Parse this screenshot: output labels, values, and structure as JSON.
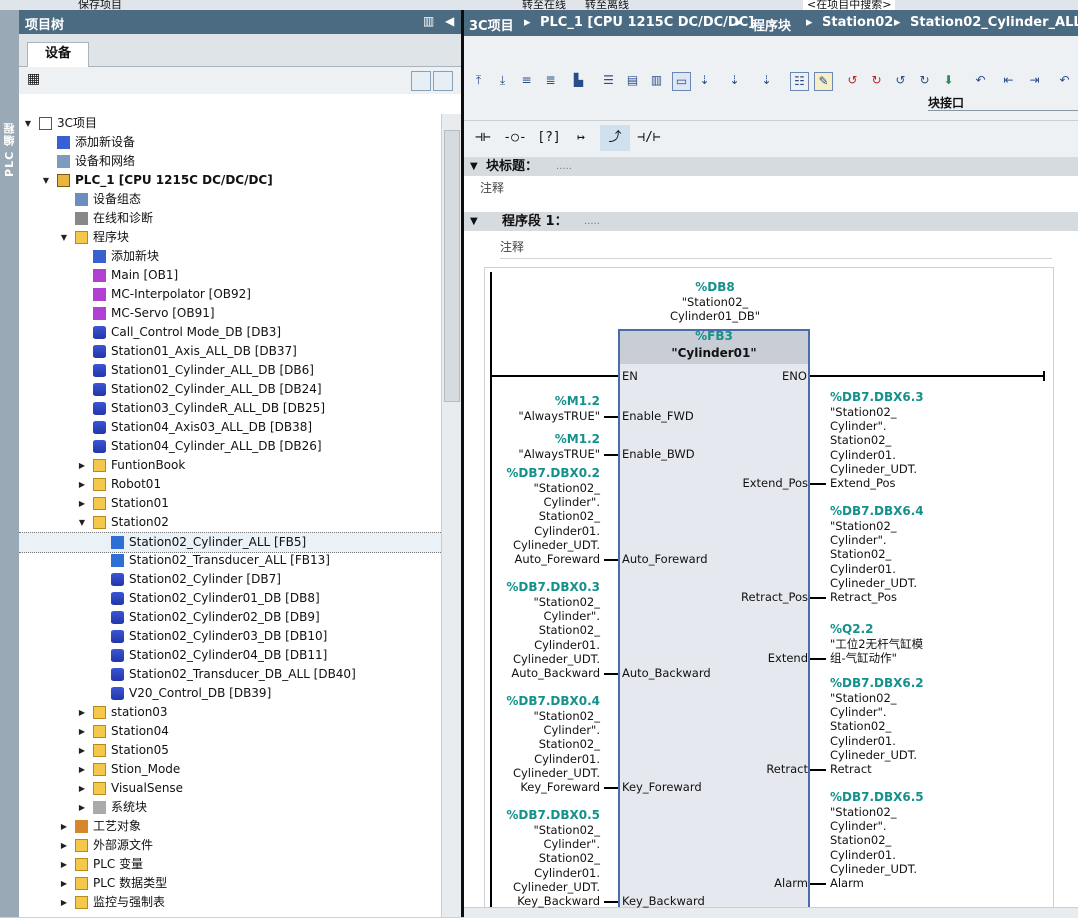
{
  "topbar": {
    "items": [
      "保存项目",
      "转至在线",
      "转至离线",
      "<在项目中搜索>"
    ]
  },
  "left_tab": {
    "label": "PLC 编程"
  },
  "tree_panel": {
    "title": "项目树",
    "tab": "设备",
    "rows": [
      {
        "arrow": "▼",
        "icon": "proj",
        "label": "3C项目"
      },
      {
        "arrow": "",
        "icon": "add",
        "label": "添加新设备"
      },
      {
        "arrow": "",
        "icon": "net",
        "label": "设备和网络"
      },
      {
        "arrow": "▼",
        "icon": "plc",
        "label": "PLC_1 [CPU 1215C DC/DC/DC]",
        "bold": true
      },
      {
        "arrow": "",
        "icon": "dev",
        "label": "设备组态"
      },
      {
        "arrow": "",
        "icon": "online",
        "label": "在线和诊断"
      },
      {
        "arrow": "▼",
        "icon": "folder",
        "label": "程序块"
      },
      {
        "arrow": "",
        "icon": "add",
        "label": "添加新块"
      },
      {
        "arrow": "",
        "icon": "ob",
        "label": "Main [OB1]"
      },
      {
        "arrow": "",
        "icon": "ob",
        "label": "MC-Interpolator [OB92]"
      },
      {
        "arrow": "",
        "icon": "ob",
        "label": "MC-Servo [OB91]"
      },
      {
        "arrow": "",
        "icon": "db",
        "label": "Call_Control Mode_DB [DB3]"
      },
      {
        "arrow": "",
        "icon": "db",
        "label": "Station01_Axis_ALL_DB [DB37]"
      },
      {
        "arrow": "",
        "icon": "db",
        "label": "Station01_Cylinder_ALL_DB [DB6]"
      },
      {
        "arrow": "",
        "icon": "db",
        "label": "Station02_Cylinder_ALL_DB [DB24]"
      },
      {
        "arrow": "",
        "icon": "db",
        "label": "Station03_CylindeR_ALL_DB [DB25]"
      },
      {
        "arrow": "",
        "icon": "db",
        "label": "Station04_Axis03_ALL_DB [DB38]"
      },
      {
        "arrow": "",
        "icon": "db",
        "label": "Station04_Cylinder_ALL_DB [DB26]"
      },
      {
        "arrow": "▶",
        "icon": "folder",
        "label": "FuntionBook"
      },
      {
        "arrow": "▶",
        "icon": "folder",
        "label": "Robot01"
      },
      {
        "arrow": "▶",
        "icon": "folder",
        "label": "Station01"
      },
      {
        "arrow": "▼",
        "icon": "folder",
        "label": "Station02"
      },
      {
        "arrow": "",
        "icon": "fb",
        "label": "Station02_Cylinder_ALL [FB5]",
        "selected": true
      },
      {
        "arrow": "",
        "icon": "fb",
        "label": "Station02_Transducer_ALL [FB13]"
      },
      {
        "arrow": "",
        "icon": "db",
        "label": "Station02_Cylinder [DB7]"
      },
      {
        "arrow": "",
        "icon": "db",
        "label": "Station02_Cylinder01_DB [DB8]"
      },
      {
        "arrow": "",
        "icon": "db",
        "label": "Station02_Cylinder02_DB [DB9]"
      },
      {
        "arrow": "",
        "icon": "db",
        "label": "Station02_Cylinder03_DB [DB10]"
      },
      {
        "arrow": "",
        "icon": "db",
        "label": "Station02_Cylinder04_DB [DB11]"
      },
      {
        "arrow": "",
        "icon": "db",
        "label": "Station02_Transducer_DB_ALL [DB40]"
      },
      {
        "arrow": "",
        "icon": "db",
        "label": "V20_Control_DB [DB39]"
      },
      {
        "arrow": "▶",
        "icon": "folder",
        "label": "station03"
      },
      {
        "arrow": "▶",
        "icon": "folder",
        "label": "Station04"
      },
      {
        "arrow": "▶",
        "icon": "folder",
        "label": "Station05"
      },
      {
        "arrow": "▶",
        "icon": "folder",
        "label": "Stion_Mode"
      },
      {
        "arrow": "▶",
        "icon": "folder",
        "label": "VisualSense"
      },
      {
        "arrow": "▶",
        "icon": "sys",
        "label": "系统块"
      },
      {
        "arrow": "▶",
        "icon": "tech",
        "label": "工艺对象"
      },
      {
        "arrow": "▶",
        "icon": "folder",
        "label": "外部源文件"
      },
      {
        "arrow": "▶",
        "icon": "folder",
        "label": "PLC 变量"
      },
      {
        "arrow": "▶",
        "icon": "folder",
        "label": "PLC 数据类型"
      },
      {
        "arrow": "▶",
        "icon": "folder",
        "label": "监控与强制表"
      }
    ]
  },
  "editor": {
    "breadcrumb": [
      "3C项目",
      "PLC_1 [CPU 1215C DC/DC/DC]",
      "程序块",
      "Station02",
      "Station02_Cylinder_ALL [F"
    ],
    "interface_label": "块接口",
    "block_title_label": "块标题：",
    "block_title_value": ".....",
    "block_comment": "注释",
    "network_label": "程序段 1：",
    "network_title_value": ".....",
    "network_comment": "注释",
    "instance_db_addr": "%DB8",
    "instance_db_name_1": "\"Station02_",
    "instance_db_name_2": "Cylinder01_DB\"",
    "fb_addr": "%FB3",
    "fb_name": "\"Cylinder01\"",
    "pin_en": "EN",
    "pin_eno": "ENO",
    "inputs": [
      {
        "pin": "Enable_FWD",
        "addr": "%M1.2",
        "lines": [
          "\"AlwaysTRUE\""
        ]
      },
      {
        "pin": "Enable_BWD",
        "addr": "%M1.2",
        "lines": [
          "\"AlwaysTRUE\""
        ]
      },
      {
        "pin": "Auto_Foreward",
        "addr": "%DB7.DBX0.2",
        "lines": [
          "\"Station02_",
          "Cylinder\".",
          "Station02_",
          "Cylinder01.",
          "Cylineder_UDT.",
          "Auto_Foreward"
        ]
      },
      {
        "pin": "Auto_Backward",
        "addr": "%DB7.DBX0.3",
        "lines": [
          "\"Station02_",
          "Cylinder\".",
          "Station02_",
          "Cylinder01.",
          "Cylineder_UDT.",
          "Auto_Backward"
        ]
      },
      {
        "pin": "Key_Foreward",
        "addr": "%DB7.DBX0.4",
        "lines": [
          "\"Station02_",
          "Cylinder\".",
          "Station02_",
          "Cylinder01.",
          "Cylineder_UDT.",
          "Key_Foreward"
        ]
      },
      {
        "pin": "Key_Backward",
        "addr": "%DB7.DBX0.5",
        "lines": [
          "\"Station02_",
          "Cylinder\".",
          "Station02_",
          "Cylinder01.",
          "Cylineder_UDT.",
          "Key_Backward"
        ]
      }
    ],
    "outputs": [
      {
        "pin": "Extend_Pos",
        "addr": "%DB7.DBX6.3",
        "lines": [
          "\"Station02_",
          "Cylinder\".",
          "Station02_",
          "Cylinder01.",
          "Cylineder_UDT.",
          "Extend_Pos"
        ]
      },
      {
        "pin": "Retract_Pos",
        "addr": "%DB7.DBX6.4",
        "lines": [
          "\"Station02_",
          "Cylinder\".",
          "Station02_",
          "Cylinder01.",
          "Cylineder_UDT.",
          "Retract_Pos"
        ]
      },
      {
        "pin": "Extend",
        "addr": "%Q2.2",
        "lines": [
          "\"工位2无杆气缸模",
          "组-气缸动作\""
        ]
      },
      {
        "pin": "Retract",
        "addr": "%DB7.DBX6.2",
        "lines": [
          "\"Station02_",
          "Cylinder\".",
          "Station02_",
          "Cylinder01.",
          "Cylineder_UDT.",
          "Retract"
        ]
      },
      {
        "pin": "Alarm",
        "addr": "%DB7.DBX6.5",
        "lines": [
          "\"Station02_",
          "Cylinder\".",
          "Station02_",
          "Cylinder01.",
          "Cylineder_UDT.",
          "Alarm"
        ]
      }
    ],
    "ladder_tools": [
      "⊣⊢",
      "⊣/⊢",
      "-( )-",
      "??",
      "↦",
      "⤴",
      "⊣/|⊢"
    ]
  }
}
